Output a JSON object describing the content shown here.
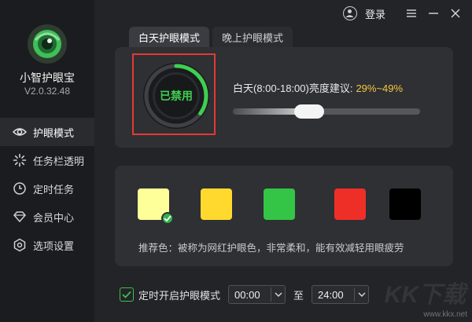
{
  "app": {
    "name": "小智护眼宝",
    "version": "V2.0.32.48",
    "logo_icon": "eye-logo-icon"
  },
  "sidebar": {
    "items": [
      {
        "label": "护眼模式",
        "icon": "eye-icon",
        "active": true
      },
      {
        "label": "任务栏透明",
        "icon": "sparkle-icon",
        "active": false
      },
      {
        "label": "定时任务",
        "icon": "clock-icon",
        "active": false
      },
      {
        "label": "会员中心",
        "icon": "diamond-icon",
        "active": false
      },
      {
        "label": "选项设置",
        "icon": "gear-icon",
        "active": false
      }
    ]
  },
  "topbar": {
    "login_label": "登录",
    "icons": [
      "user-icon",
      "menu-icon",
      "minimize-icon",
      "close-icon"
    ]
  },
  "tabs": [
    {
      "label": "白天护眼模式",
      "active": true
    },
    {
      "label": "晚上护眼模式",
      "active": false
    }
  ],
  "status": {
    "label": "已禁用",
    "ring_progress": 0.35
  },
  "brightness": {
    "label": "白天(8:00-18:00)亮度建议:",
    "range": "29%~49%",
    "slider_value": 0.39
  },
  "colors": {
    "swatches": [
      "#ffff99",
      "#ffd92e",
      "#34c446",
      "#ee2f28",
      "#000000"
    ],
    "selected_index": 0,
    "recommend_text": "推荐色：被称为网红护眼色，非常柔和，能有效减轻用眼疲劳"
  },
  "schedule": {
    "checkbox_label": "定时开启护眼模式",
    "checked": true,
    "start": "00:00",
    "to_label": "至",
    "end": "24:00"
  },
  "watermark": {
    "logo_text": "KK下载",
    "url": "www.kkx.net"
  },
  "theme": {
    "accent": "#3fcf4f",
    "highlight": "#f5c842",
    "alert": "#e53935"
  }
}
